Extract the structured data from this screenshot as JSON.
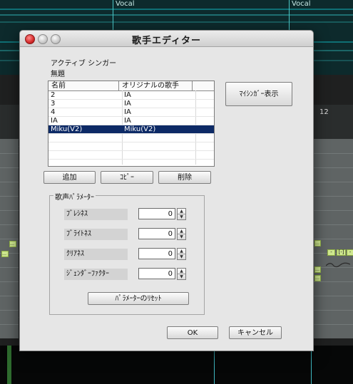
{
  "background": {
    "track_labels": [
      "Vocal",
      "Vocal"
    ],
    "ruler_number": "12",
    "note_marks": [
      "…",
      "…",
      "…",
      "-",
      "[-]",
      "-",
      "…",
      "…"
    ]
  },
  "dialog": {
    "title": "歌手エディター",
    "active_singer_label": "アクティブ シンガー",
    "active_singer_value": "無題",
    "list": {
      "columns": [
        "名前",
        "オリジナルの歌手"
      ],
      "rows": [
        {
          "name": "2",
          "original": "IA"
        },
        {
          "name": "3",
          "original": "IA"
        },
        {
          "name": "4",
          "original": "IA"
        },
        {
          "name": "IA",
          "original": "IA"
        },
        {
          "name": "Miku(V2)",
          "original": "Miku(V2)",
          "selected": true
        }
      ]
    },
    "my_singer_button": "ﾏｲｼﾝｶﾞｰ表示",
    "add_button": "追加",
    "copy_button": "ｺﾋﾟｰ",
    "delete_button": "削除",
    "params_group_title": "歌声ﾊﾟﾗﾒｰﾀｰ",
    "params": [
      {
        "label": "ﾌﾞﾚｼﾈｽ",
        "value": "0"
      },
      {
        "label": "ﾌﾞﾗｲﾄﾈｽ",
        "value": "0"
      },
      {
        "label": "ｸﾘｱﾈｽ",
        "value": "0"
      },
      {
        "label": "ｼﾞｪﾝﾀﾞｰﾌｧｸﾀｰ",
        "value": "0"
      }
    ],
    "reset_button": "ﾊﾟﾗﾒｰﾀｰのﾘｾｯﾄ",
    "ok_button": "OK",
    "cancel_button": "キャンセル"
  }
}
